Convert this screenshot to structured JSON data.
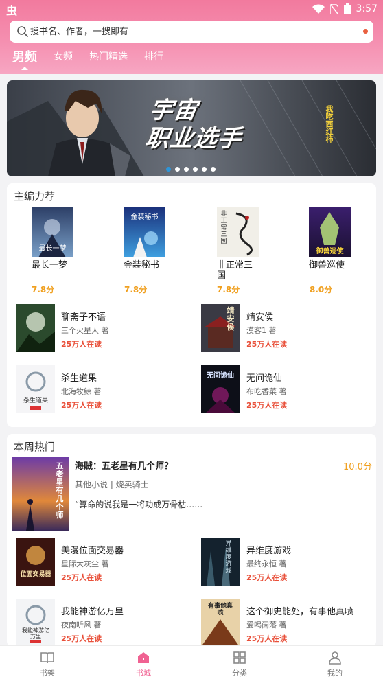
{
  "status_bar": {
    "time": "3:57",
    "app_logo": "虫"
  },
  "search": {
    "placeholder": "搜书名、作者，一搜即有"
  },
  "tabs": [
    {
      "label": "男频",
      "active": true
    },
    {
      "label": "女频",
      "active": false
    },
    {
      "label": "热门精选",
      "active": false
    },
    {
      "label": "排行",
      "active": false
    }
  ],
  "banner": {
    "title_line1": "宇宙",
    "title_line2": "职业选手",
    "author": "我吃西红柿",
    "slides": 6,
    "active_slide": 0
  },
  "editor_picks": {
    "title": "主编力荐",
    "grid": [
      {
        "title": "最长一梦",
        "score": "7.8分",
        "cover_text": "最长一梦"
      },
      {
        "title": "金装秘书",
        "score": "7.8分",
        "cover_text": "金装秘书"
      },
      {
        "title": "非正常三国",
        "score": "7.8分",
        "cover_text": "非正常三国"
      },
      {
        "title": "御兽巡使",
        "score": "8.0分",
        "cover_text": "御兽巡使"
      }
    ],
    "list": [
      {
        "title": "聊斋子不语",
        "author": "三个火星人 著",
        "reading": "25万人在读"
      },
      {
        "title": "靖安侯",
        "author": "漠客1 著",
        "reading": "25万人在读",
        "cover_text": "靖安侯"
      },
      {
        "title": "杀生道果",
        "author": "北海牧鲸 著",
        "reading": "25万人在读",
        "cover_text": "杀生道果"
      },
      {
        "title": "无间诡仙",
        "author": "布吃香菜 著",
        "reading": "25万人在读",
        "cover_text": "无间诡仙"
      }
    ]
  },
  "weekly_hot": {
    "title": "本周热门",
    "featured": {
      "title": "海贼：五老星有几个师？",
      "score": "10.0分",
      "meta": "其他小说 | 烧卖骑士",
      "excerpt": "“算命的说我是一将功成万骨枯……",
      "cover_text": "五老星有几个师"
    },
    "list": [
      {
        "title": "美漫位面交易器",
        "author": "星际大灰尘 著",
        "reading": "25万人在读",
        "cover_text": "位面交易器"
      },
      {
        "title": "异维度游戏",
        "author": "最终永恒 著",
        "reading": "25万人在读",
        "cover_text": "异维度游戏"
      },
      {
        "title": "我能神游亿万里",
        "author": "夜南听风 著",
        "reading": "25万人在读",
        "cover_text": "我能神游亿万里"
      },
      {
        "title": "这个御史能处，有事他真喷",
        "author": "爱喝阔落 著",
        "reading": "25万人在读",
        "cover_text": "有事他真喷"
      }
    ]
  },
  "bottom_nav": [
    {
      "label": "书架",
      "active": false
    },
    {
      "label": "书城",
      "active": true
    },
    {
      "label": "分类",
      "active": false
    },
    {
      "label": "我的",
      "active": false
    }
  ],
  "colors": {
    "brand_pink": "#f27a9e",
    "score": "#f0a020",
    "reading": "#e9503a",
    "active_nav": "#f06292",
    "dot_active": "#2e95d8"
  }
}
